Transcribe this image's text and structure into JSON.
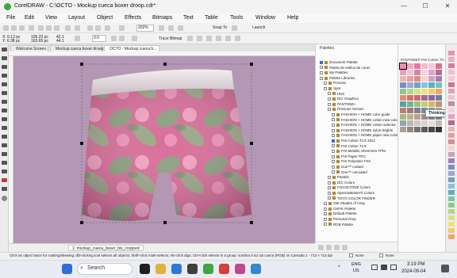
{
  "window": {
    "title": "CorelDRAW - C:\\OCTO - Mockup cueca boxer droop.cdr*",
    "minimize": "—",
    "maximize": "☐",
    "close": "✕"
  },
  "menu": [
    "File",
    "Edit",
    "View",
    "Layout",
    "Object",
    "Effects",
    "Bitmaps",
    "Text",
    "Table",
    "Tools",
    "Window",
    "Help"
  ],
  "toolbar": {
    "preset": "Custom",
    "x": "X: 0.12 pc",
    "y": "Y: 6.38 pc",
    "width": "106.22 pc",
    "height": "163.65 pc",
    "scale_w": "42.1",
    "scale_h": "44.1",
    "angle": "0.0",
    "zoom": "202%",
    "snap_to": "Snap To",
    "launch": "Launch",
    "trace_bitmap": "Trace Bitmap"
  },
  "tabs": [
    "Welcome Screen",
    "Mockup cueca boxer droop.cdr*",
    "OCTO - Mockup cueca b..."
  ],
  "page_tab": "1: mockup_cueca_boxer_bis_cropped",
  "dock": {
    "title": "Palettes",
    "tree": [
      {
        "label": "Document Palette",
        "indent": 0,
        "checked": true
      },
      {
        "label": "Paleta de estilos de cores",
        "indent": 0,
        "checked": false
      },
      {
        "label": "My Palettes",
        "indent": 0,
        "checked": false
      },
      {
        "label": "Palette Libraries",
        "indent": 0,
        "checked": false
      },
      {
        "label": "Process",
        "indent": 1,
        "checked": false
      },
      {
        "label": "Spot",
        "indent": 1,
        "checked": false
      },
      {
        "label": "HKS",
        "indent": 2,
        "checked": false
      },
      {
        "label": "DIC Graphics",
        "indent": 2,
        "checked": false
      },
      {
        "label": "PANTONE+",
        "indent": 2,
        "checked": false
      },
      {
        "label": "Previous Version",
        "indent": 2,
        "checked": false
      },
      {
        "label": "FASHION + HOME color guide",
        "indent": 3,
        "checked": false
      },
      {
        "label": "FASHION + HOME cotton new colors",
        "indent": 3,
        "checked": false
      },
      {
        "label": "FASHION + HOME cotton selector",
        "indent": 3,
        "checked": false
      },
      {
        "label": "FASHION + HOME nylon brights",
        "indent": 3,
        "checked": false
      },
      {
        "label": "FASHION + HOME paper new colors",
        "indent": 3,
        "checked": false
      },
      {
        "label": "FHI Cotton TCX 2021",
        "indent": 3,
        "checked": true
      },
      {
        "label": "FHI Cotton TCX",
        "indent": 3,
        "checked": false
      },
      {
        "label": "FHI Metallic Shimmers TPM",
        "indent": 3,
        "checked": false
      },
      {
        "label": "FHI Paper TPG",
        "indent": 3,
        "checked": false
      },
      {
        "label": "FHI Polyester TSX",
        "indent": 3,
        "checked": false
      },
      {
        "label": "Goe™ coated",
        "indent": 3,
        "checked": false
      },
      {
        "label": "Goe™ uncoated",
        "indent": 3,
        "checked": false
      },
      {
        "label": "Pastels",
        "indent": 2,
        "checked": false
      },
      {
        "label": "DIC Colors",
        "indent": 2,
        "checked": false
      },
      {
        "label": "FOCOLTONE Colors",
        "indent": 2,
        "checked": false
      },
      {
        "label": "SpectraMaster® Colors",
        "indent": 2,
        "checked": false
      },
      {
        "label": "TOYO COLOR FINDER",
        "indent": 2,
        "checked": false
      },
      {
        "label": "256 Shades of Gray",
        "indent": 1,
        "checked": false
      },
      {
        "label": "CMYK Palette",
        "indent": 1,
        "checked": false
      },
      {
        "label": "Default Palette",
        "indent": 1,
        "checked": false
      },
      {
        "label": "Personal Gray",
        "indent": 1,
        "checked": false
      },
      {
        "label": "RGB Palette",
        "indent": 1,
        "checked": false
      }
    ]
  },
  "palette": {
    "title": "PANTONE® FHI Cotton TC...",
    "tooltip": "Thinking Pink",
    "colors": [
      "#ef8fb6",
      "#f3a7c5",
      "#e7779f",
      "#f5bcd0",
      "#f8c8d8",
      "#d96e97",
      "#e8a0b8",
      "#f2c2cc",
      "#c98aa6",
      "#f4d2dc",
      "#e4a1c7",
      "#b56a94",
      "#efb3b5",
      "#e89ea2",
      "#d88c8e",
      "#f6d2cc",
      "#cfa0c0",
      "#9f7fb3",
      "#7c8bc6",
      "#9aa8d4",
      "#6fa1c8",
      "#8cc3d9",
      "#59b3bb",
      "#79c6b0",
      "#8fc98a",
      "#b4d68a",
      "#d7e27f",
      "#f0e27a",
      "#f3c96d",
      "#f2a56b",
      "#e98a68",
      "#de6f62",
      "#c86a7a",
      "#a66b8a",
      "#8a6b95",
      "#6b7fa5",
      "#5aa0a0",
      "#6fb68f",
      "#9cc27b",
      "#c9cc76",
      "#d8b56a",
      "#c8916a",
      "#b58070",
      "#9c7a7d",
      "#877f8f",
      "#748ca0",
      "#6aa0a8",
      "#80b49a",
      "#a1b888",
      "#c0b27d",
      "#bba08a",
      "#a08d91",
      "#8e8a9b",
      "#7a8fa8",
      "#9aa1ad",
      "#b4b6b8",
      "#cbc7c2",
      "#d9d3cc",
      "#e3ddd6",
      "#c2bbb5",
      "#a79f99",
      "#8e8782",
      "#76706c",
      "#5f5a57",
      "#4a4644",
      "#363332"
    ],
    "selected": "#ef8fb6"
  },
  "status": {
    "hint": "Click an object twice for rotating/skewing; dbl-clicking tool selects all objects; Shift+click multi-selects; Alt+click digs; Ctrl+click selects in a group",
    "document": "sombra à luz da cueca (RGB) on Camada 1 · 713 × 713 dpi",
    "fill": "None",
    "outline": "None"
  },
  "taskbar": {
    "search": "Search",
    "lang_top": "ENG",
    "lang_bottom": "US",
    "time": "3:19 PM",
    "date": "2024-09-04"
  }
}
